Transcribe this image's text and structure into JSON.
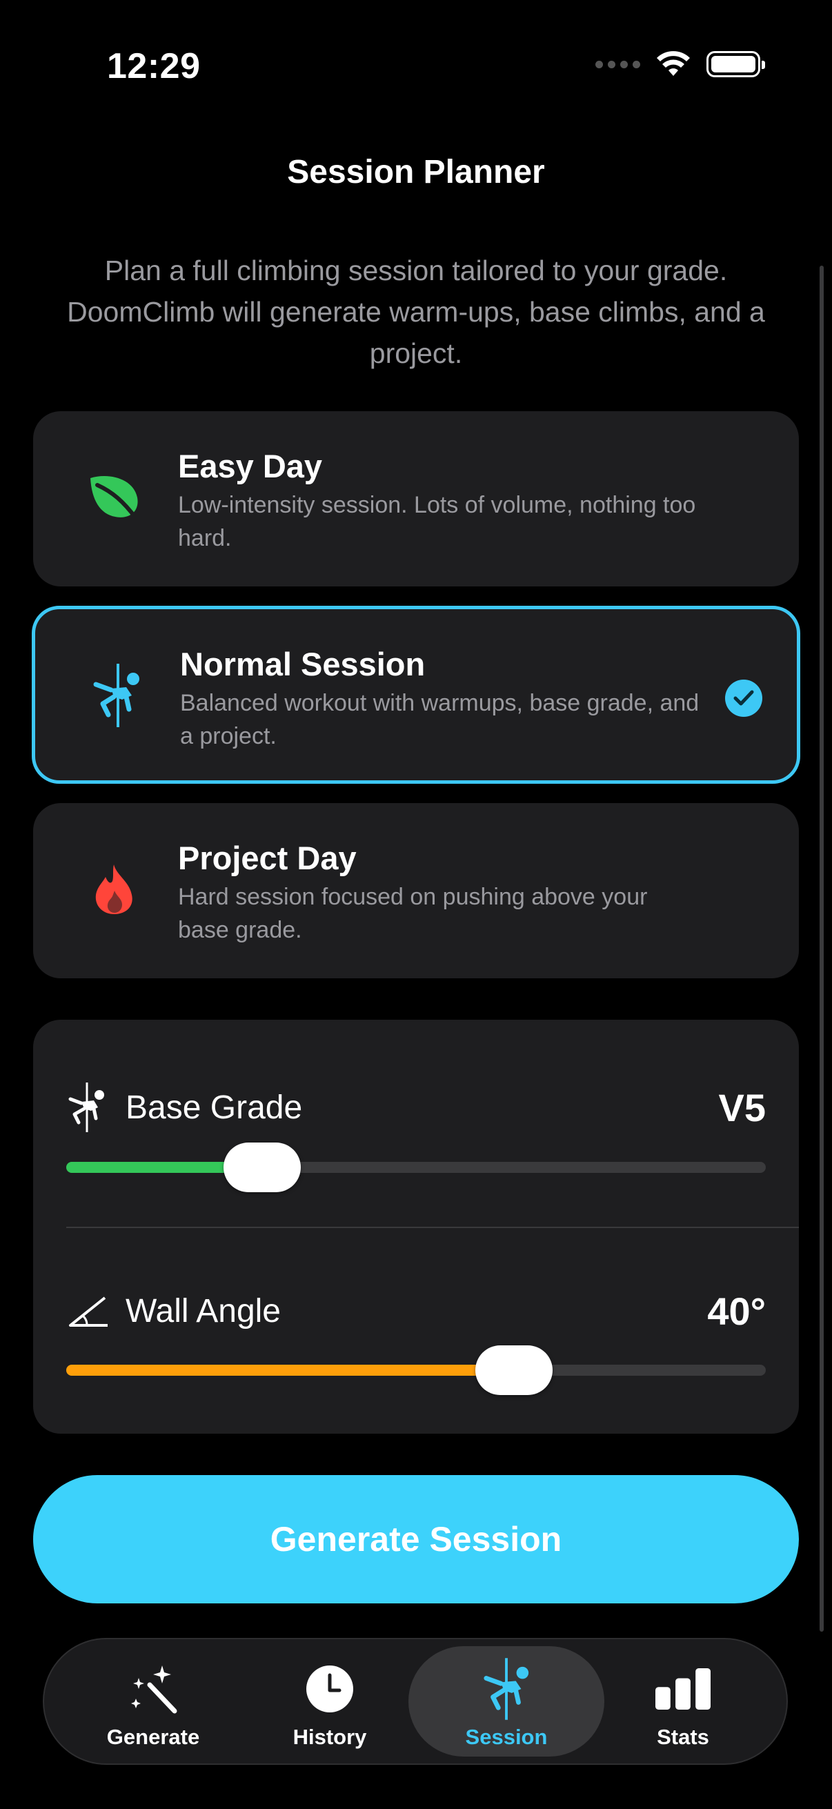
{
  "status_bar": {
    "time": "12:29"
  },
  "nav": {
    "title": "Session Planner"
  },
  "intro": "Plan a full climbing session tailored to your grade. DoomClimb will generate warm-ups, base climbs, and a project.",
  "session_types": [
    {
      "title": "Easy Day",
      "description": "Low-intensity session. Lots of volume, nothing too hard.",
      "icon": "leaf-icon",
      "color": "#34c759",
      "selected": false
    },
    {
      "title": "Normal Session",
      "description": "Balanced workout with warmups, base grade, and a project.",
      "icon": "climber-icon",
      "color": "#3dc8f5",
      "selected": true
    },
    {
      "title": "Project Day",
      "description": "Hard session focused on pushing above your base grade.",
      "icon": "flame-icon",
      "color": "#ff453a",
      "selected": false
    }
  ],
  "sliders": {
    "base_grade": {
      "label": "Base Grade",
      "value": "V5",
      "fraction": 0.28,
      "color": "#34c759",
      "icon": "climber-icon"
    },
    "wall_angle": {
      "label": "Wall Angle",
      "value": "40°",
      "fraction": 0.64,
      "color": "#ff9f0a",
      "icon": "angle-icon"
    }
  },
  "generate_button": {
    "label": "Generate Session",
    "color": "#3dd2fb"
  },
  "tabs": [
    {
      "label": "Generate",
      "icon": "magic-wand-icon",
      "active": false
    },
    {
      "label": "History",
      "icon": "clock-icon",
      "active": false
    },
    {
      "label": "Session",
      "icon": "climber-icon",
      "active": true
    },
    {
      "label": "Stats",
      "icon": "bar-chart-icon",
      "active": false
    }
  ],
  "colors": {
    "accent": "#3dc8f5",
    "card_bg": "#1e1e20",
    "background": "#000000"
  }
}
